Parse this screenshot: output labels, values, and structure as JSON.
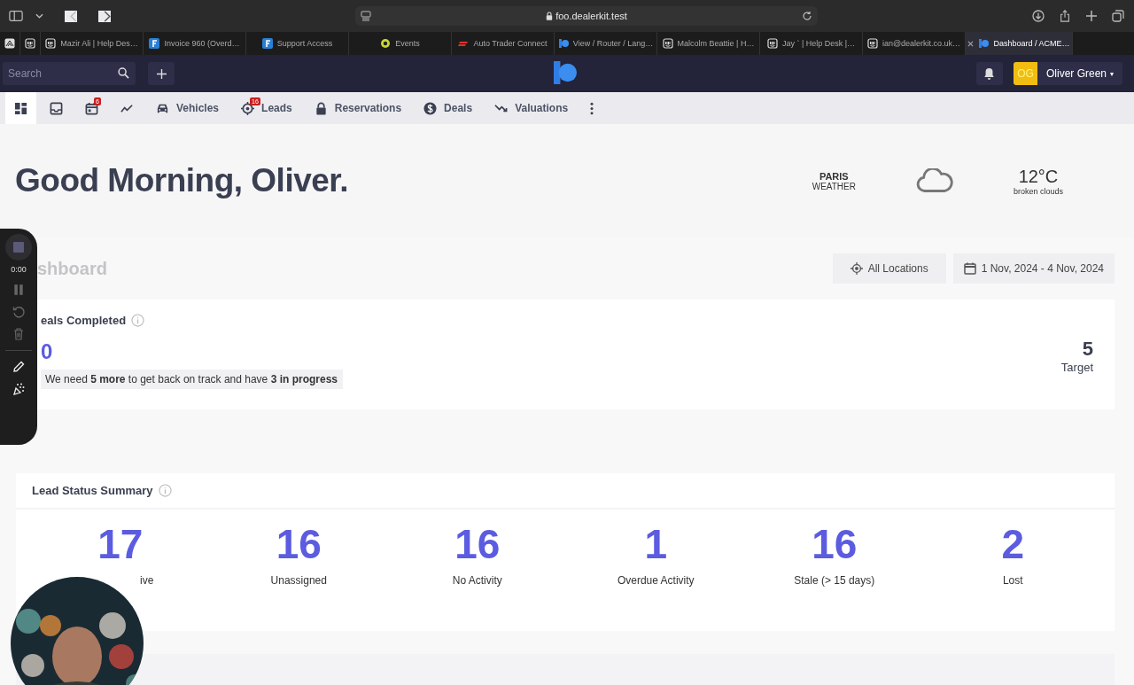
{
  "browser": {
    "url": "foo.dealerkit.test"
  },
  "pinned_tabs": [
    {
      "kind": "stack"
    },
    {
      "kind": "desk"
    }
  ],
  "tabs": [
    {
      "kind": "desk",
      "label": "Mazir Ali | Help Des…",
      "selected": false
    },
    {
      "kind": "f",
      "label": "Invoice 960 (Overd…",
      "selected": false
    },
    {
      "kind": "f",
      "label": "Support Access",
      "selected": false
    },
    {
      "kind": "events",
      "label": "Events",
      "selected": false
    },
    {
      "kind": "autotrader",
      "label": "Auto Trader Connect",
      "selected": false
    },
    {
      "kind": "k",
      "label": "View / Router / Lang…",
      "selected": false
    },
    {
      "kind": "desk",
      "label": "Malcolm Beattie | H…",
      "selected": false
    },
    {
      "kind": "desk",
      "label": "Jay ˋ | Help Desk |…",
      "selected": false
    },
    {
      "kind": "desk",
      "label": "ian@dealerkit.co.uk…",
      "selected": false
    },
    {
      "kind": "k",
      "label": "Dashboard / ACME…",
      "selected": true
    }
  ],
  "header": {
    "search": {
      "placeholder": "Search"
    },
    "user": {
      "initials": "OG",
      "name": "Oliver Green",
      "caret": "▾"
    }
  },
  "nav": [
    {
      "kind": "dashboard",
      "selected": true
    },
    {
      "kind": "inbox",
      "selected": false
    },
    {
      "kind": "calendar",
      "badge": "6",
      "selected": false
    },
    {
      "kind": "chart",
      "selected": false
    },
    {
      "kind": "car",
      "label": "Vehicles",
      "selected": false
    },
    {
      "kind": "target",
      "label": "Leads",
      "badge": "16",
      "selected": false
    },
    {
      "kind": "lock",
      "label": "Reservations",
      "selected": false
    },
    {
      "kind": "dollar",
      "label": "Deals",
      "selected": false
    },
    {
      "kind": "trend",
      "label": "Valuations",
      "selected": false
    },
    {
      "kind": "more",
      "selected": false
    }
  ],
  "greeting": "Good Morning, Oliver.",
  "weather": {
    "city": "PARIS",
    "label": "WEATHER",
    "temperature": "12°C",
    "description": "broken clouds"
  },
  "dashboard": {
    "heading": "shboard",
    "location": "All Locations",
    "date_range": "1 Nov, 2024 - 4 Nov, 2024"
  },
  "deals_card": {
    "title": "eals Completed",
    "value": "0",
    "message": "We need **5 more** to get back on track and have **3 in progress**",
    "target": "5",
    "target_label": "Target"
  },
  "lead_summary": {
    "title": "Lead Status Summary",
    "stats": [
      {
        "value": "17",
        "label": "ive"
      },
      {
        "value": "16",
        "label": "Unassigned"
      },
      {
        "value": "16",
        "label": "No Activity"
      },
      {
        "value": "1",
        "label": "Overdue Activity"
      },
      {
        "value": "16",
        "label": "Stale (> 15 days)"
      },
      {
        "value": "2",
        "label": "Lost"
      }
    ]
  },
  "recorder": {
    "time": "0:00"
  }
}
